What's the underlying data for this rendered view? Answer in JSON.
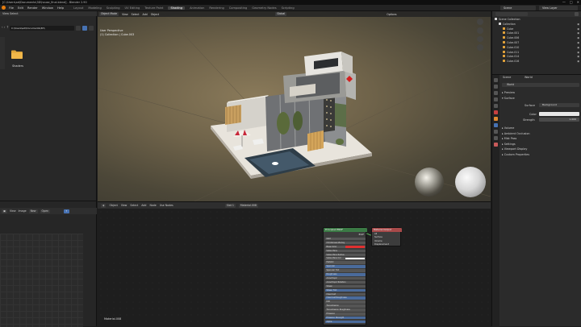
{
  "titlebar": {
    "text": "[C:\\Users\\ad\\Documents\\3D\\house_final.blend] - Blender 2.90",
    "controls": [
      "—",
      "□",
      "✕"
    ]
  },
  "menus": [
    "File",
    "Edit",
    "Render",
    "Window",
    "Help"
  ],
  "workspaces": [
    {
      "label": "Layout",
      "active": false
    },
    {
      "label": "Modeling",
      "active": false
    },
    {
      "label": "Sculpting",
      "active": false
    },
    {
      "label": "UV Editing",
      "active": false
    },
    {
      "label": "Texture Paint",
      "active": false
    },
    {
      "label": "Shading",
      "active": true
    },
    {
      "label": "Animation",
      "active": false
    },
    {
      "label": "Rendering",
      "active": false
    },
    {
      "label": "Compositing",
      "active": false
    },
    {
      "label": "Geometry Nodes",
      "active": false
    },
    {
      "label": "Scripting",
      "active": false
    }
  ],
  "scene": {
    "label": "Scene",
    "view_layer": "View Layer"
  },
  "filebrowser": {
    "header": "View   Select",
    "path": "C:\\Users\\ad\\Documents\\3D\\",
    "folder_label": "Shaders"
  },
  "image_editor": {
    "mode": "View",
    "view": "View",
    "image": "Image",
    "new_label": "New",
    "open_label": "Open"
  },
  "viewport": {
    "header_items": [
      "Object Mode",
      "View",
      "Select",
      "Add",
      "Object"
    ],
    "global": "Global",
    "options": "Options",
    "info_line1": "User Perspective",
    "info_line2": "(1) Collection | Cube.003"
  },
  "outliner": {
    "rows": [
      {
        "label": "Scene Collection",
        "indent": 0
      },
      {
        "label": "Collection",
        "indent": 1
      },
      {
        "label": "Cube",
        "indent": 2
      },
      {
        "label": "Cube.001",
        "indent": 2
      },
      {
        "label": "Cube.006",
        "indent": 2
      },
      {
        "label": "Cube.007",
        "indent": 2
      },
      {
        "label": "Cube.010",
        "indent": 2
      },
      {
        "label": "Cube.011",
        "indent": 2
      },
      {
        "label": "Cube.014",
        "indent": 2
      },
      {
        "label": "Cube.016",
        "indent": 2
      }
    ]
  },
  "properties": {
    "scene_label": "Scene",
    "world_label": "World",
    "world_name": "World",
    "preview_label": "Preview",
    "surface_label": "Surface",
    "surface_value": "Background",
    "color_label": "Color",
    "strength_label": "Strength",
    "strength_value": "1.000",
    "panels": [
      "Volume",
      "Ambient Occlusion",
      "Mist Pass",
      "Settings",
      "Viewport Display",
      "Custom Properties"
    ]
  },
  "node_editor": {
    "header_items": [
      "Object",
      "View",
      "Select",
      "Add",
      "Node",
      "Use Nodes"
    ],
    "slot": "Slot 1",
    "material": "Material.008",
    "material_label": "Material.008",
    "bsdf_title": "Principled BSDF",
    "bsdf_rows": [
      {
        "label": "BSDF",
        "style": "plain"
      },
      {
        "label": "GGX",
        "style": "grey"
      },
      {
        "label": "Christensen-Burley",
        "style": "grey"
      },
      {
        "label": "Base Color",
        "style": "red"
      },
      {
        "label": "Subsurface",
        "style": "grey"
      },
      {
        "label": "Subsurface Radius",
        "style": "grey"
      },
      {
        "label": "Subsurface Col",
        "style": "white"
      },
      {
        "label": "Metallic",
        "style": "grey"
      },
      {
        "label": "Specular",
        "style": "blue"
      },
      {
        "label": "Specular Tint",
        "style": "grey"
      },
      {
        "label": "Roughness",
        "style": "blue"
      },
      {
        "label": "Anisotropic",
        "style": "grey"
      },
      {
        "label": "Anisotropic Rotation",
        "style": "grey"
      },
      {
        "label": "Sheen",
        "style": "grey"
      },
      {
        "label": "Sheen Tint",
        "style": "blue"
      },
      {
        "label": "Clearcoat",
        "style": "grey"
      },
      {
        "label": "Clearcoat Roughness",
        "style": "blue"
      },
      {
        "label": "IOR",
        "style": "grey"
      },
      {
        "label": "Transmission",
        "style": "grey"
      },
      {
        "label": "Transmission Roughness",
        "style": "grey"
      },
      {
        "label": "Emission",
        "style": "grey"
      },
      {
        "label": "Emission Strength",
        "style": "blue"
      },
      {
        "label": "Alpha",
        "style": "blue"
      }
    ],
    "output_title": "Material Output",
    "output_rows": [
      "All",
      "Surface",
      "Volume",
      "Displacement"
    ]
  },
  "colors": {
    "accent": "#4772b3",
    "bsdf_header": "#3b7a45",
    "output_header": "#a84a4a",
    "base_color": "#e03030"
  }
}
